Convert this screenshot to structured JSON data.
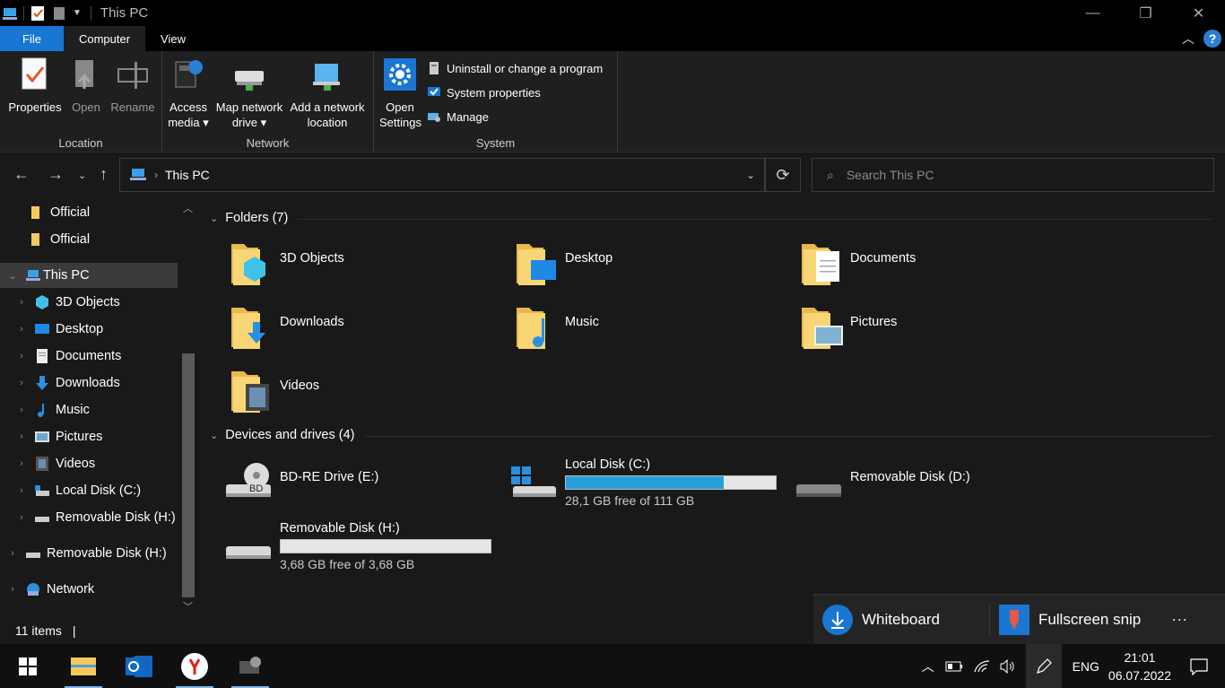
{
  "window": {
    "title": "This PC",
    "minimize": "—",
    "restore": "❐",
    "close": "✕"
  },
  "tabs": {
    "file": "File",
    "computer": "Computer",
    "view": "View"
  },
  "ribbon": {
    "location": {
      "label": "Location",
      "properties": "Properties",
      "open": "Open",
      "rename": "Rename"
    },
    "network": {
      "label": "Network",
      "access_media_1": "Access",
      "access_media_2": "media ▾",
      "map_drive_1": "Map network",
      "map_drive_2": "drive ▾",
      "add_location_1": "Add a network",
      "add_location_2": "location"
    },
    "system": {
      "label": "System",
      "open_settings_1": "Open",
      "open_settings_2": "Settings",
      "uninstall": "Uninstall or change a program",
      "system_properties": "System properties",
      "manage": "Manage"
    }
  },
  "address": {
    "path": "This PC",
    "search_placeholder": "Search This PC"
  },
  "navpane": {
    "items": [
      {
        "label": "Official"
      },
      {
        "label": "Official"
      },
      {
        "label": "This PC"
      },
      {
        "label": "3D Objects"
      },
      {
        "label": "Desktop"
      },
      {
        "label": "Documents"
      },
      {
        "label": "Downloads"
      },
      {
        "label": "Music"
      },
      {
        "label": "Pictures"
      },
      {
        "label": "Videos"
      },
      {
        "label": "Local Disk (C:)"
      },
      {
        "label": "Removable Disk (H:)"
      },
      {
        "label": "Removable Disk (H:)"
      },
      {
        "label": "Network"
      }
    ]
  },
  "content": {
    "folders_header": "Folders (7)",
    "folders": [
      {
        "label": "3D Objects"
      },
      {
        "label": "Desktop"
      },
      {
        "label": "Documents"
      },
      {
        "label": "Downloads"
      },
      {
        "label": "Music"
      },
      {
        "label": "Pictures"
      },
      {
        "label": "Videos"
      }
    ],
    "drives_header": "Devices and drives (4)",
    "drives": [
      {
        "label": "BD-RE Drive (E:)"
      },
      {
        "label": "Local Disk (C:)",
        "free": "28,1 GB free of 111 GB",
        "used_fraction": 0.75
      },
      {
        "label": "Removable Disk (D:)"
      },
      {
        "label": "Removable Disk (H:)",
        "free": "3,68 GB free of 3,68 GB",
        "used_fraction": 0
      }
    ]
  },
  "status": {
    "items": "11 items",
    "sep": "|"
  },
  "snip": {
    "whiteboard": "Whiteboard",
    "fullscreen": "Fullscreen snip",
    "more": "···"
  },
  "taskbar": {
    "language": "ENG",
    "time": "21:01",
    "date": "06.07.2022"
  },
  "colors": {
    "accent": "#1976d2",
    "disk_fill": "#26a0da",
    "folder": "#f5c95c"
  }
}
